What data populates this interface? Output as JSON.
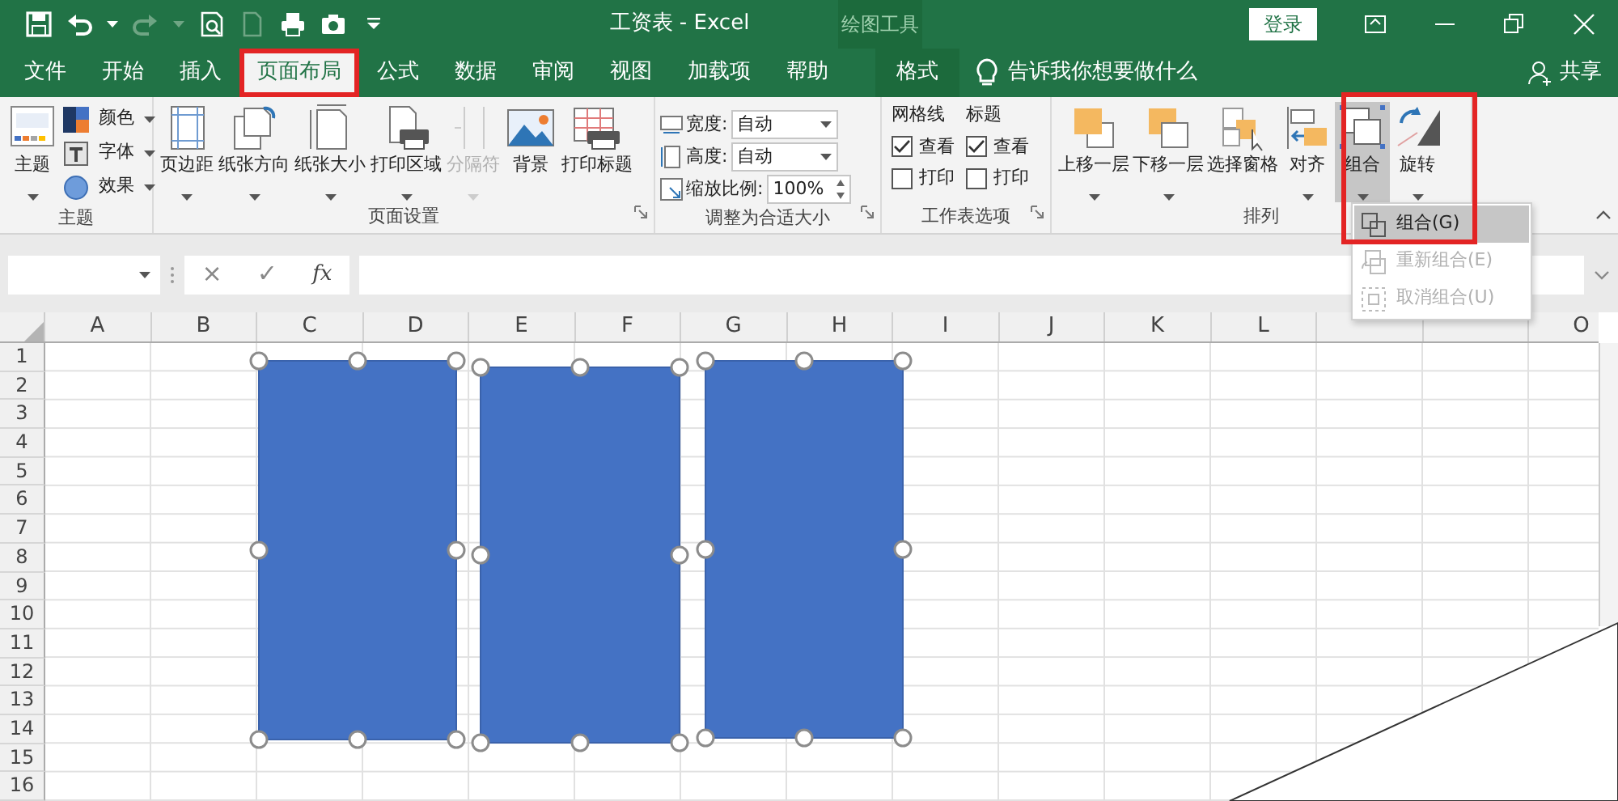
{
  "window": {
    "title": "工资表 - Excel",
    "context_group": "绘图工具",
    "sign_in": "登录"
  },
  "quick_access": [
    {
      "disabled": false
    },
    {
      "disabled": false
    },
    {
      "disabled": true
    },
    {
      "disabled": false
    },
    {
      "disabled": true
    },
    {
      "disabled": false
    },
    {
      "disabled": false
    },
    {
      "disabled": false
    }
  ],
  "tabs": [
    {
      "label": "文件",
      "selected": false,
      "framed": false,
      "contextual": false
    },
    {
      "label": "开始",
      "selected": false,
      "framed": false,
      "contextual": false
    },
    {
      "label": "插入",
      "selected": false,
      "framed": false,
      "contextual": false
    },
    {
      "label": "页面布局",
      "selected": true,
      "framed": true,
      "contextual": false
    },
    {
      "label": "公式",
      "selected": false,
      "framed": false,
      "contextual": false
    },
    {
      "label": "数据",
      "selected": false,
      "framed": false,
      "contextual": false
    },
    {
      "label": "审阅",
      "selected": false,
      "framed": false,
      "contextual": false
    },
    {
      "label": "视图",
      "selected": false,
      "framed": false,
      "contextual": false
    },
    {
      "label": "加载项",
      "selected": false,
      "framed": false,
      "contextual": false
    },
    {
      "label": "帮助",
      "selected": false,
      "framed": false,
      "contextual": false
    },
    {
      "label": "格式",
      "selected": false,
      "framed": false,
      "contextual": true
    }
  ],
  "tell_me": "告诉我你想要做什么",
  "share": "共享",
  "ribbon": {
    "groups": [
      {
        "label": "主题",
        "launcher": false,
        "controls": [
          {
            "kind": "large",
            "label": "主题",
            "dropdown": true,
            "disabled": false,
            "pressed": false
          },
          {
            "kind": "stack",
            "items": [
              {
                "label": "颜色"
              },
              {
                "label": "字体"
              },
              {
                "label": "效果"
              }
            ]
          }
        ]
      },
      {
        "label": "页面设置",
        "launcher": true,
        "controls": [
          {
            "kind": "large",
            "label": "页边距",
            "dropdown": true,
            "disabled": false,
            "pressed": false
          },
          {
            "kind": "large",
            "label": "纸张方向",
            "dropdown": true,
            "disabled": false,
            "pressed": false
          },
          {
            "kind": "large",
            "label": "纸张大小",
            "dropdown": true,
            "disabled": false,
            "pressed": false
          },
          {
            "kind": "large",
            "label": "打印区域",
            "dropdown": true,
            "disabled": false,
            "pressed": false
          },
          {
            "kind": "large",
            "label": "分隔符",
            "dropdown": true,
            "disabled": true,
            "pressed": false
          },
          {
            "kind": "large",
            "label": "背景",
            "dropdown": false,
            "disabled": false,
            "pressed": false
          },
          {
            "kind": "large",
            "label": "打印标题",
            "dropdown": false,
            "disabled": false,
            "pressed": false
          }
        ]
      },
      {
        "label": "调整为合适大小",
        "launcher": true,
        "controls": [
          {
            "kind": "fields",
            "items": [
              {
                "label": "宽度:",
                "value": "自动",
                "spin": false
              },
              {
                "label": "高度:",
                "value": "自动",
                "spin": false
              },
              {
                "label": "缩放比例:",
                "value": "100%",
                "spin": true
              }
            ]
          }
        ]
      },
      {
        "label": "工作表选项",
        "launcher": true,
        "controls": [
          {
            "kind": "checks",
            "title": "网格线",
            "items": [
              {
                "label": "查看",
                "checked": true
              },
              {
                "label": "打印",
                "checked": false
              }
            ]
          },
          {
            "kind": "checks",
            "title": "标题",
            "items": [
              {
                "label": "查看",
                "checked": true
              },
              {
                "label": "打印",
                "checked": false
              }
            ]
          }
        ]
      },
      {
        "label": "排列",
        "launcher": false,
        "controls": [
          {
            "kind": "large",
            "label": "上移一层",
            "dropdown": true,
            "disabled": false,
            "pressed": false
          },
          {
            "kind": "large",
            "label": "下移一层",
            "dropdown": true,
            "disabled": false,
            "pressed": false
          },
          {
            "kind": "large",
            "label": "选择窗格",
            "dropdown": false,
            "disabled": false,
            "pressed": false
          },
          {
            "kind": "large",
            "label": "对齐",
            "dropdown": true,
            "disabled": false,
            "pressed": false
          },
          {
            "kind": "large",
            "label": "组合",
            "dropdown": true,
            "disabled": false,
            "pressed": true
          },
          {
            "kind": "large",
            "label": "旋转",
            "dropdown": true,
            "disabled": false,
            "pressed": false
          }
        ]
      }
    ]
  },
  "formula_bar": {
    "cancel": "×",
    "enter": "✓",
    "function": "fx"
  },
  "sheet": {
    "columns": [
      "A",
      "B",
      "C",
      "D",
      "E",
      "F",
      "G",
      "H",
      "I",
      "J",
      "K",
      "L"
    ],
    "columns_after_menu": [
      "O"
    ],
    "rows": [
      "1",
      "2",
      "3",
      "4",
      "5",
      "6",
      "7",
      "8",
      "9",
      "10",
      "11",
      "12",
      "13",
      "14",
      "15",
      "16"
    ],
    "shapes": [
      {
        "selected": true
      },
      {
        "selected": true
      },
      {
        "selected": true
      }
    ]
  },
  "menu": {
    "framed": true,
    "items": [
      {
        "label": "组合(G)",
        "selected": true,
        "disabled": false
      },
      {
        "label": "重新组合(E)",
        "selected": false,
        "disabled": true
      },
      {
        "label": "取消组合(U)",
        "selected": false,
        "disabled": true
      }
    ]
  },
  "page_curl": true
}
